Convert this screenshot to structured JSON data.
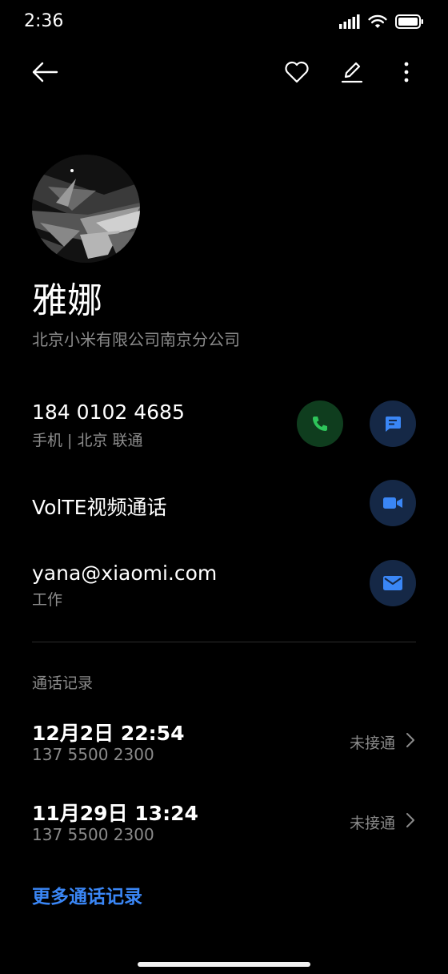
{
  "status_bar": {
    "time": "2:36"
  },
  "contact": {
    "name": "雅娜",
    "company": "北京小米有限公司南京分公司"
  },
  "phone": {
    "number": "184 0102 4685",
    "detail": "手机 | 北京 联通"
  },
  "video_call": {
    "label": "VolTE视频通话"
  },
  "email": {
    "address": "yana@xiaomi.com",
    "type": "工作"
  },
  "call_log": {
    "title": "通话记录",
    "entries": [
      {
        "datetime": "12月2日  22:54",
        "number": "137 5500 2300",
        "status": "未接通"
      },
      {
        "datetime": "11月29日  13:24",
        "number": "137 5500 2300",
        "status": "未接通"
      }
    ],
    "more_label": "更多通话记录"
  },
  "colors": {
    "accent": "#3a86f5",
    "call_green": "#2ec45a",
    "call_green_bg": "#0f3d1e",
    "blue_btn_bg": "#152846"
  },
  "icons": [
    "back-arrow-icon",
    "heart-icon",
    "edit-icon",
    "more-icon",
    "phone-icon",
    "message-icon",
    "video-icon",
    "mail-icon",
    "chevron-right-icon"
  ]
}
